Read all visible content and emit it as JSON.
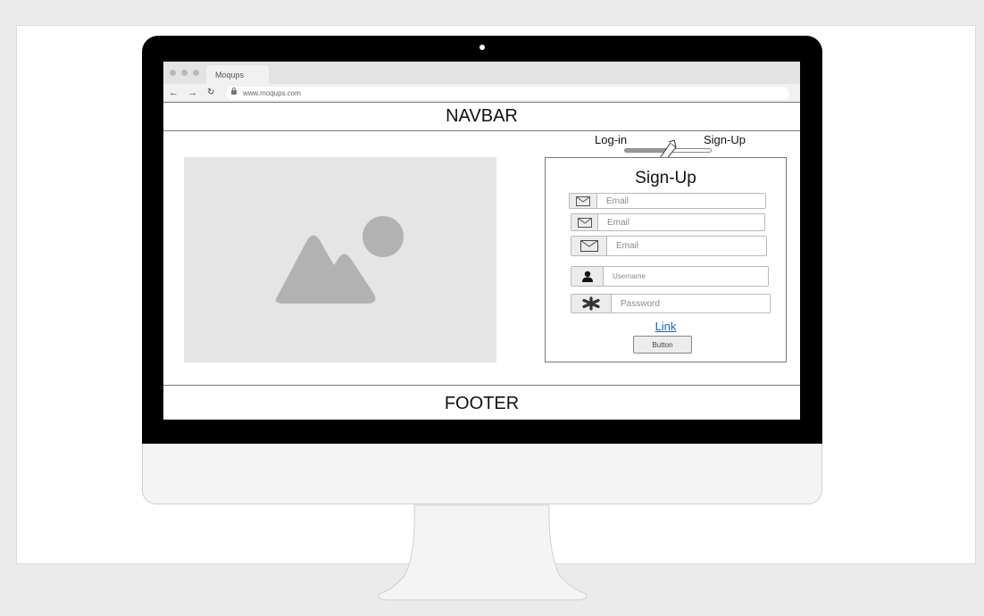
{
  "browser": {
    "tab_title": "Moqups",
    "url": "www.moqups.com",
    "back_icon": "arrow-left-icon",
    "forward_icon": "arrow-right-icon",
    "reload_icon": "reload-icon"
  },
  "header": {
    "navbar_label": "NAVBAR"
  },
  "footer": {
    "label": "FOOTER"
  },
  "toggle": {
    "left_label": "Log-in",
    "right_label": "Sign-Up",
    "position": 0.5
  },
  "form": {
    "title": "Sign-Up",
    "fields": [
      {
        "icon": "envelope-icon",
        "placeholder": "Email"
      },
      {
        "icon": "envelope-icon",
        "placeholder": "Email"
      },
      {
        "icon": "envelope-icon",
        "placeholder": "Email"
      },
      {
        "icon": "user-icon",
        "placeholder": "Username"
      },
      {
        "icon": "asterisk-icon",
        "placeholder": "Password"
      }
    ],
    "link_label": "Link",
    "button_label": "Button"
  },
  "colors": {
    "link": "#1a5fc1",
    "frame": "#000000",
    "placeholder_bg": "#e5e5e5"
  }
}
